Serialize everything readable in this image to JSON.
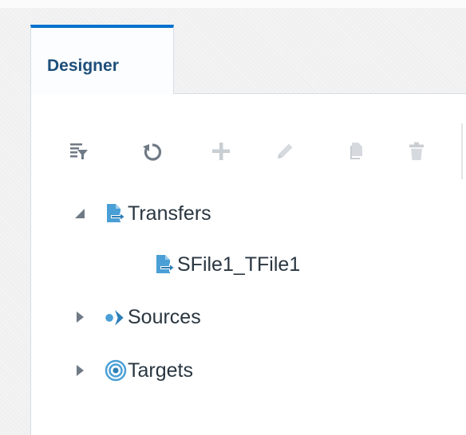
{
  "tabs": [
    {
      "label": "Designer",
      "active": true
    }
  ],
  "toolbar": {
    "buttons": [
      {
        "name": "filter",
        "icon": "filter-list-icon",
        "enabled": true
      },
      {
        "name": "refresh",
        "icon": "refresh-icon",
        "enabled": true
      },
      {
        "name": "add",
        "icon": "plus-icon",
        "enabled": false
      },
      {
        "name": "edit",
        "icon": "pencil-icon",
        "enabled": false
      },
      {
        "name": "copy",
        "icon": "copy-icon",
        "enabled": false
      },
      {
        "name": "delete",
        "icon": "trash-icon",
        "enabled": false
      }
    ]
  },
  "tree": {
    "nodes": [
      {
        "label": "Transfers",
        "icon": "transfer-icon",
        "expanded": true,
        "children": [
          {
            "label": "SFile1_TFile1",
            "icon": "transfer-icon"
          }
        ]
      },
      {
        "label": "Sources",
        "icon": "source-icon",
        "expanded": false
      },
      {
        "label": "Targets",
        "icon": "target-icon",
        "expanded": false
      }
    ]
  },
  "colors": {
    "accent": "#0572ce",
    "tab_text": "#1d4e7a",
    "icon_blue": "#4a9fd6",
    "toolbar_enabled": "#6f7a85",
    "toolbar_disabled": "#c9ced3",
    "node_text": "#2a3640"
  }
}
